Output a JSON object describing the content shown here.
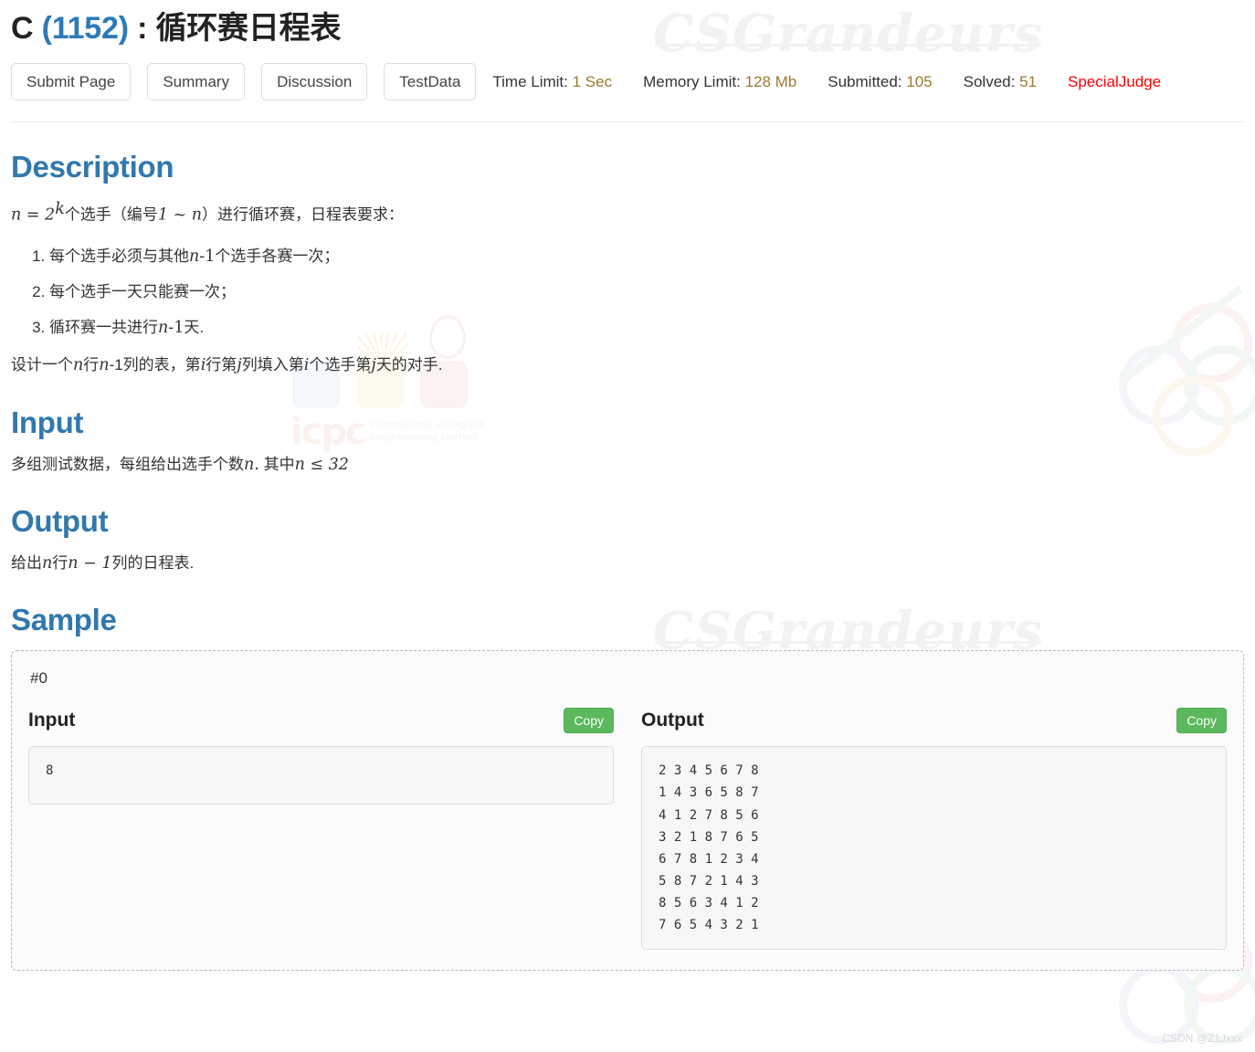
{
  "problem": {
    "letter": "C",
    "id": "(1152)",
    "separator": " : ",
    "title": "循环赛日程表"
  },
  "toolbar": {
    "buttons": [
      {
        "label": "Submit Page"
      },
      {
        "label": "Summary"
      },
      {
        "label": "Discussion"
      },
      {
        "label": "TestData"
      }
    ],
    "stats": [
      {
        "label": "Time Limit:",
        "value": "1 Sec"
      },
      {
        "label": "Memory Limit:",
        "value": "128 Mb"
      },
      {
        "label": "Submitted:",
        "value": "105"
      },
      {
        "label": "Solved:",
        "value": "51"
      }
    ],
    "special_judge": "SpecialJudge"
  },
  "sections": {
    "description_heading": "Description",
    "input_heading": "Input",
    "output_heading": "Output",
    "sample_heading": "Sample"
  },
  "description": {
    "intro_prefix": "n = 2",
    "intro_sup": "k",
    "intro_mid": "个选手（编号",
    "intro_range": "1 ~ n",
    "intro_suffix": "）进行循环赛，日程表要求：",
    "rules": [
      {
        "pre": "每个选手必须与其他",
        "math": "n",
        "mid": "-1",
        "post": "个选手各赛一次；"
      },
      {
        "pre": "每个选手一天只能赛一次；",
        "math": "",
        "mid": "",
        "post": ""
      },
      {
        "pre": "循环赛一共进行",
        "math": "n",
        "mid": "-1",
        "post": "天."
      }
    ],
    "closing": {
      "p1": "设计一个",
      "m1": "n",
      "p2": "行",
      "m2": "n",
      "p3": "-1列的表，第",
      "m3": "i",
      "p4": "行第",
      "m4": "j",
      "p5": "列填入第",
      "m5": "i",
      "p6": "个选手第",
      "m6": "j",
      "p7": "天的对手."
    }
  },
  "input_section": {
    "p1": "多组测试数据，每组给出选手个数",
    "m1": "n.",
    "p2": " 其中",
    "m2": "n ≤ 32"
  },
  "output_section": {
    "p1": "给出",
    "m1": "n",
    "p2": "行",
    "m2": "n − 1",
    "p3": "列的日程表."
  },
  "sample": {
    "case_id": "#0",
    "input_title": "Input",
    "output_title": "Output",
    "copy_label": "Copy",
    "input_text": "8",
    "output_text": "2 3 4 5 6 7 8\n1 4 3 6 5 8 7\n4 1 2 7 8 5 6\n3 2 1 8 7 6 5\n6 7 8 1 2 3 4\n5 8 7 2 1 4 3\n8 5 6 3 4 1 2\n7 6 5 4 3 2 1"
  },
  "watermarks": {
    "site": "CSGrandeurs",
    "icpc": "icpc",
    "icpc_sub_line1": "international collegiate",
    "icpc_sub_line2": "programming contest",
    "csdn": "CSDN @Z1Jxxx"
  },
  "colors": {
    "heading": "#3178ad",
    "problem_id": "#2d7ab8",
    "stat_value": "#9b7a31",
    "special_judge": "#ff0000",
    "copy_button": "#5cb85c"
  }
}
